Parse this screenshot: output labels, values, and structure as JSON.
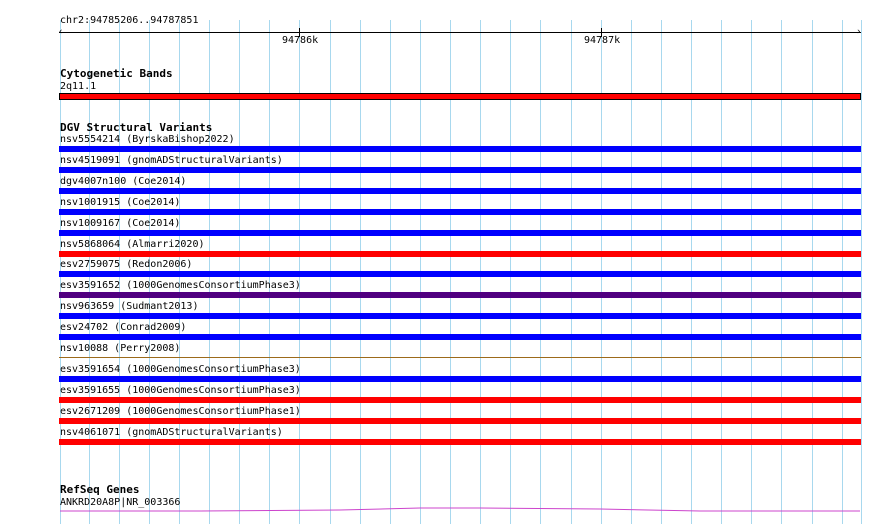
{
  "ruler": {
    "location": "chr2:94785206..94787851",
    "ticks": [
      "94786k",
      "94787k"
    ]
  },
  "tracks": {
    "cytoband": {
      "title": "Cytogenetic Bands",
      "band_label": "2q11.1",
      "band_color": "#ff0000"
    },
    "dgv": {
      "title": "DGV Structural Variants",
      "variants": [
        {
          "label": "nsv5554214 (ByrskaBishop2022)",
          "color": "#0000ff"
        },
        {
          "label": "nsv4519091 (gnomADStructuralVariants)",
          "color": "#0000ff"
        },
        {
          "label": "dgv4007n100 (Coe2014)",
          "color": "#0000ff"
        },
        {
          "label": "nsv1001915 (Coe2014)",
          "color": "#0000ff"
        },
        {
          "label": "nsv1009167 (Coe2014)",
          "color": "#0000ff"
        },
        {
          "label": "nsv5868064 (Almarri2020)",
          "color": "#ff0000"
        },
        {
          "label": "esv2759075 (Redon2006)",
          "color": "#0000ff"
        },
        {
          "label": "esv3591652 (1000GenomesConsortiumPhase3)",
          "color": "#500080"
        },
        {
          "label": "nsv963659 (Sudmant2013)",
          "color": "#0000ff"
        },
        {
          "label": "esv24702 (Conrad2009)",
          "color": "#0000ff"
        },
        {
          "label": "nsv10088 (Perry2008)",
          "color": "#9c6a1a"
        },
        {
          "label": "esv3591654 (1000GenomesConsortiumPhase3)",
          "color": "#0000ff"
        },
        {
          "label": "esv3591655 (1000GenomesConsortiumPhase3)",
          "color": "#ff0000"
        },
        {
          "label": "esv2671209 (1000GenomesConsortiumPhase1)",
          "color": "#ff0000"
        },
        {
          "label": "nsv4061071 (gnomADStructuralVariants)",
          "color": "#ff0000"
        }
      ]
    },
    "refseq": {
      "title": "RefSeq Genes",
      "gene_label": "ANKRD20A8P|NR_003366",
      "gene_color": "#cc44cc"
    }
  }
}
